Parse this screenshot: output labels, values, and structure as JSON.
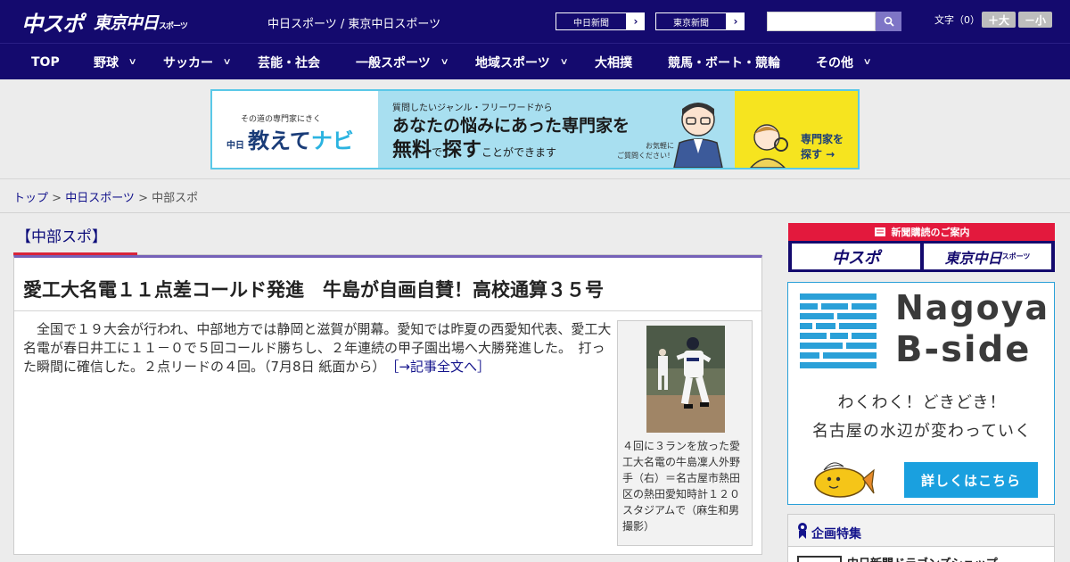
{
  "header": {
    "logo_main": "中スポ",
    "logo_tokyo": "東京中日",
    "logo_tokyo_small": "スポーツ",
    "site_links": "中日スポーツ / 東京中日スポーツ",
    "papers": [
      "中日新聞",
      "東京新聞"
    ],
    "search_placeholder": "",
    "fontsize_label": "文字（0）",
    "fontsize_up": "＋大",
    "fontsize_down": "－小"
  },
  "nav": {
    "items": [
      {
        "label": "TOP",
        "has_menu": false
      },
      {
        "label": "野球",
        "has_menu": true
      },
      {
        "label": "サッカー",
        "has_menu": true
      },
      {
        "label": "芸能・社会",
        "has_menu": false
      },
      {
        "label": "一般スポーツ",
        "has_menu": true
      },
      {
        "label": "地域スポーツ",
        "has_menu": true
      },
      {
        "label": "大相撲",
        "has_menu": false
      },
      {
        "label": "競馬・ボート・競輪",
        "has_menu": false
      },
      {
        "label": "その他",
        "has_menu": true
      }
    ],
    "chevron": "∨"
  },
  "ad_banner": {
    "left_small": "その道の専門家にきく",
    "left_chu": "中日",
    "left_main_a": "教えて",
    "left_main_b": "ナビ",
    "question": "質問したいジャンル・フリーワードから",
    "line1": "あなたの悩みにあった専門家を",
    "line2_a": "無料",
    "line2_b": "で",
    "line2_c": "探す",
    "line2_d": "ことができます",
    "note1": "お気軽に",
    "note2": "ご質問ください！",
    "right_text1": "専門家を",
    "right_text2": "探す →"
  },
  "breadcrumb": {
    "top": "トップ",
    "sep": " > ",
    "chunichi": "中日スポーツ",
    "current": "中部スポ"
  },
  "section": {
    "title": "【中部スポ】"
  },
  "article": {
    "headline": "愛工大名電１１点差コールド発進　牛島が自画自賛！高校通算３５号",
    "body": "全国で１９大会が行われ、中部地方では静岡と滋賀が開幕。愛知では昨夏の西愛知代表、愛工大名電が春日井工に１１－０で５回コールド勝ちし、２年連続の甲子園出場へ大勝発進した。　打った瞬間に確信した。２点リードの４回。（7月8日 紙面から）",
    "more_link": "［→記事全文へ］",
    "caption": "４回に３ランを放った愛工大名電の牛島凜人外野手（右）＝名古屋市熱田区の熱田愛知時計１２０スタジアムで（麻生和男撮影）"
  },
  "sidebar": {
    "subscribe_head": "新聞購読のご案内",
    "sub_btn1": "中スポ",
    "sub_btn2": "東京中日",
    "sub_btn2_small": "スポーツ",
    "bside_word1": "Nagoya",
    "bside_word2": "B-side",
    "bside_line1": "わくわく！どきどき！",
    "bside_line2": "名古屋の水辺が変わっていく",
    "bside_cta": "詳しくはこちら",
    "feature_title": "企画特集",
    "feature_item": "中日新聞ドラゴンズショップ"
  },
  "colors": {
    "header_bg": "#140a6e",
    "accent_red": "#e3193d",
    "article_top": "#7561b8",
    "link": "#14148c",
    "bside_blue": "#1aa0df"
  }
}
